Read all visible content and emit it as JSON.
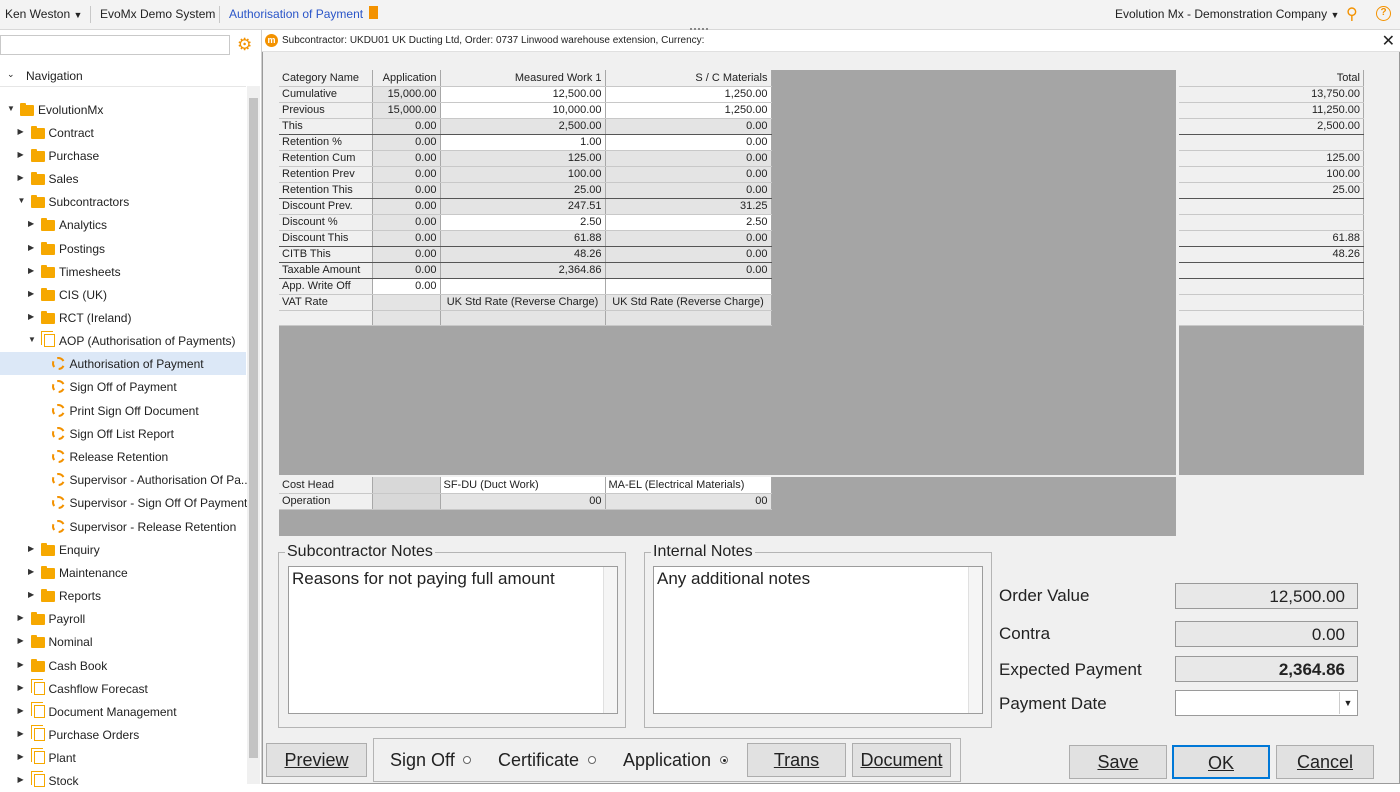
{
  "topbar": {
    "user": "Ken Weston",
    "system": "EvoMx Demo System",
    "active_tab": "Authorisation of Payment",
    "company": "Evolution Mx - Demonstration Company"
  },
  "nav": {
    "header": "Navigation",
    "items": [
      {
        "label": "EvolutionMx"
      },
      {
        "label": "Contract"
      },
      {
        "label": "Purchase"
      },
      {
        "label": "Sales"
      },
      {
        "label": "Subcontractors"
      },
      {
        "label": "Analytics"
      },
      {
        "label": "Postings"
      },
      {
        "label": "Timesheets"
      },
      {
        "label": "CIS (UK)"
      },
      {
        "label": "RCT (Ireland)"
      },
      {
        "label": "AOP (Authorisation of Payments)"
      },
      {
        "label": "Authorisation of Payment"
      },
      {
        "label": "Sign Off of Payment"
      },
      {
        "label": "Print Sign Off Document"
      },
      {
        "label": "Sign Off List Report"
      },
      {
        "label": "Release Retention"
      },
      {
        "label": "Supervisor - Authorisation Of Pa..."
      },
      {
        "label": "Supervisor - Sign Off Of Payment"
      },
      {
        "label": "Supervisor - Release Retention"
      },
      {
        "label": "Enquiry"
      },
      {
        "label": "Maintenance"
      },
      {
        "label": "Reports"
      },
      {
        "label": "Payroll"
      },
      {
        "label": "Nominal"
      },
      {
        "label": "Cash Book"
      },
      {
        "label": "Cashflow Forecast"
      },
      {
        "label": "Document Management"
      },
      {
        "label": "Purchase Orders"
      },
      {
        "label": "Plant"
      },
      {
        "label": "Stock"
      }
    ]
  },
  "dialog": {
    "title": "Subcontractor: UKDU01 UK Ducting Ltd, Order: 0737 Linwood warehouse extension, Currency:",
    "grid": {
      "headers": [
        "Category Name",
        "Application",
        "Measured Work 1",
        "S / C  Materials"
      ],
      "rows": [
        [
          "Cumulative",
          "15,000.00",
          "12,500.00",
          "1,250.00"
        ],
        [
          "Previous",
          "15,000.00",
          "10,000.00",
          "1,250.00"
        ],
        [
          "This",
          "0.00",
          "2,500.00",
          "0.00"
        ],
        [
          "Retention %",
          "0.00",
          "1.00",
          "0.00"
        ],
        [
          "Retention Cum",
          "0.00",
          "125.00",
          "0.00"
        ],
        [
          "Retention Prev",
          "0.00",
          "100.00",
          "0.00"
        ],
        [
          "Retention This",
          "0.00",
          "25.00",
          "0.00"
        ],
        [
          "Discount Prev.",
          "0.00",
          "247.51",
          "31.25"
        ],
        [
          "Discount %",
          "0.00",
          "2.50",
          "2.50"
        ],
        [
          "Discount This",
          "0.00",
          "61.88",
          "0.00"
        ],
        [
          "CITB This",
          "0.00",
          "48.26",
          "0.00"
        ],
        [
          "Taxable Amount",
          "0.00",
          "2,364.86",
          "0.00"
        ],
        [
          "App. Write Off",
          "0.00",
          "",
          ""
        ],
        [
          "VAT Rate",
          "",
          "UK Std Rate (Reverse Charge)",
          "UK Std Rate (Reverse Charge)"
        ]
      ]
    },
    "totals": {
      "header": "Total",
      "rows": [
        "13,750.00",
        "11,250.00",
        "2,500.00",
        "",
        "125.00",
        "100.00",
        "25.00",
        "",
        "",
        "61.88",
        "48.26",
        "",
        "",
        ""
      ]
    },
    "cost_grid": {
      "rows": [
        [
          "Cost Head",
          "",
          "SF-DU (Duct Work)",
          "MA-EL (Electrical Materials)"
        ],
        [
          "Operation",
          "",
          "00",
          "00"
        ]
      ]
    },
    "subcontractor_notes": {
      "label": "Subcontractor Notes",
      "text": "Reasons for not paying full amount"
    },
    "internal_notes": {
      "label": "Internal Notes",
      "text": "Any additional notes"
    },
    "summary": {
      "order_value_label": "Order Value",
      "order_value": "12,500.00",
      "contra_label": "Contra",
      "contra": "0.00",
      "expected_label": "Expected Payment",
      "expected": "2,364.86",
      "payment_date_label": "Payment Date",
      "payment_date": ""
    },
    "buttons": {
      "preview": "Preview",
      "trans": "Trans",
      "document": "Document",
      "save": "Save",
      "ok": "OK",
      "cancel": "Cancel"
    },
    "radios": {
      "sign_off": "Sign Off",
      "certificate": "Certificate",
      "application": "Application",
      "selected": "application"
    }
  }
}
